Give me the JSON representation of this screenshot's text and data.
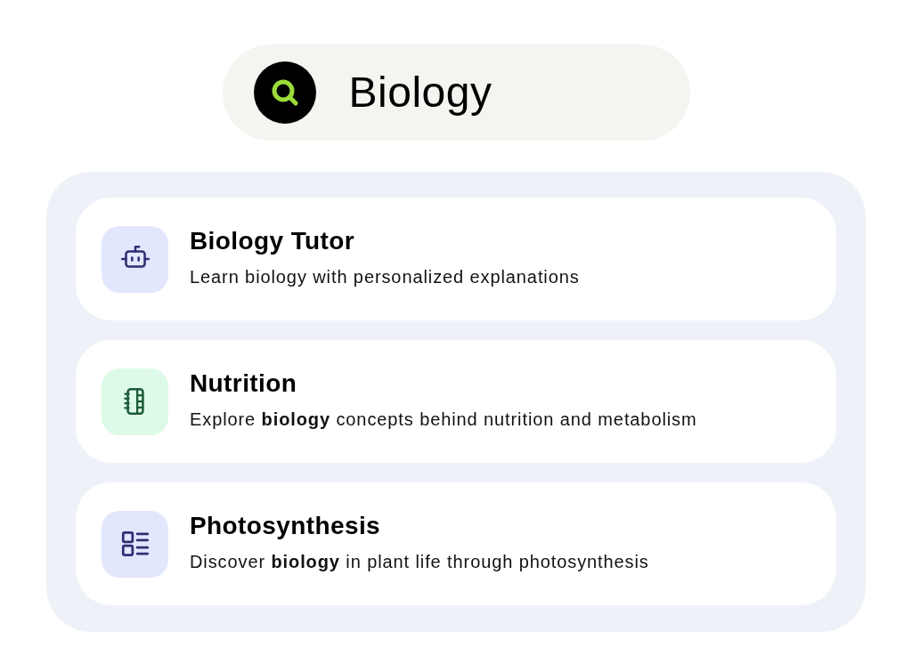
{
  "search": {
    "value": "Biology"
  },
  "results": [
    {
      "kind": "robot",
      "color": "#e3e7fd",
      "title": "Biology Tutor",
      "description": "Learn biology with personalized explanations"
    },
    {
      "kind": "notebook",
      "color": "#dcfae7",
      "title": "Nutrition",
      "description": "Explore **biology** concepts behind nutrition and metabolism"
    },
    {
      "kind": "list",
      "color": "#e3e7fd",
      "title": "Photosynthesis",
      "description": "Discover **biology** in plant life through photosynthesis"
    }
  ]
}
